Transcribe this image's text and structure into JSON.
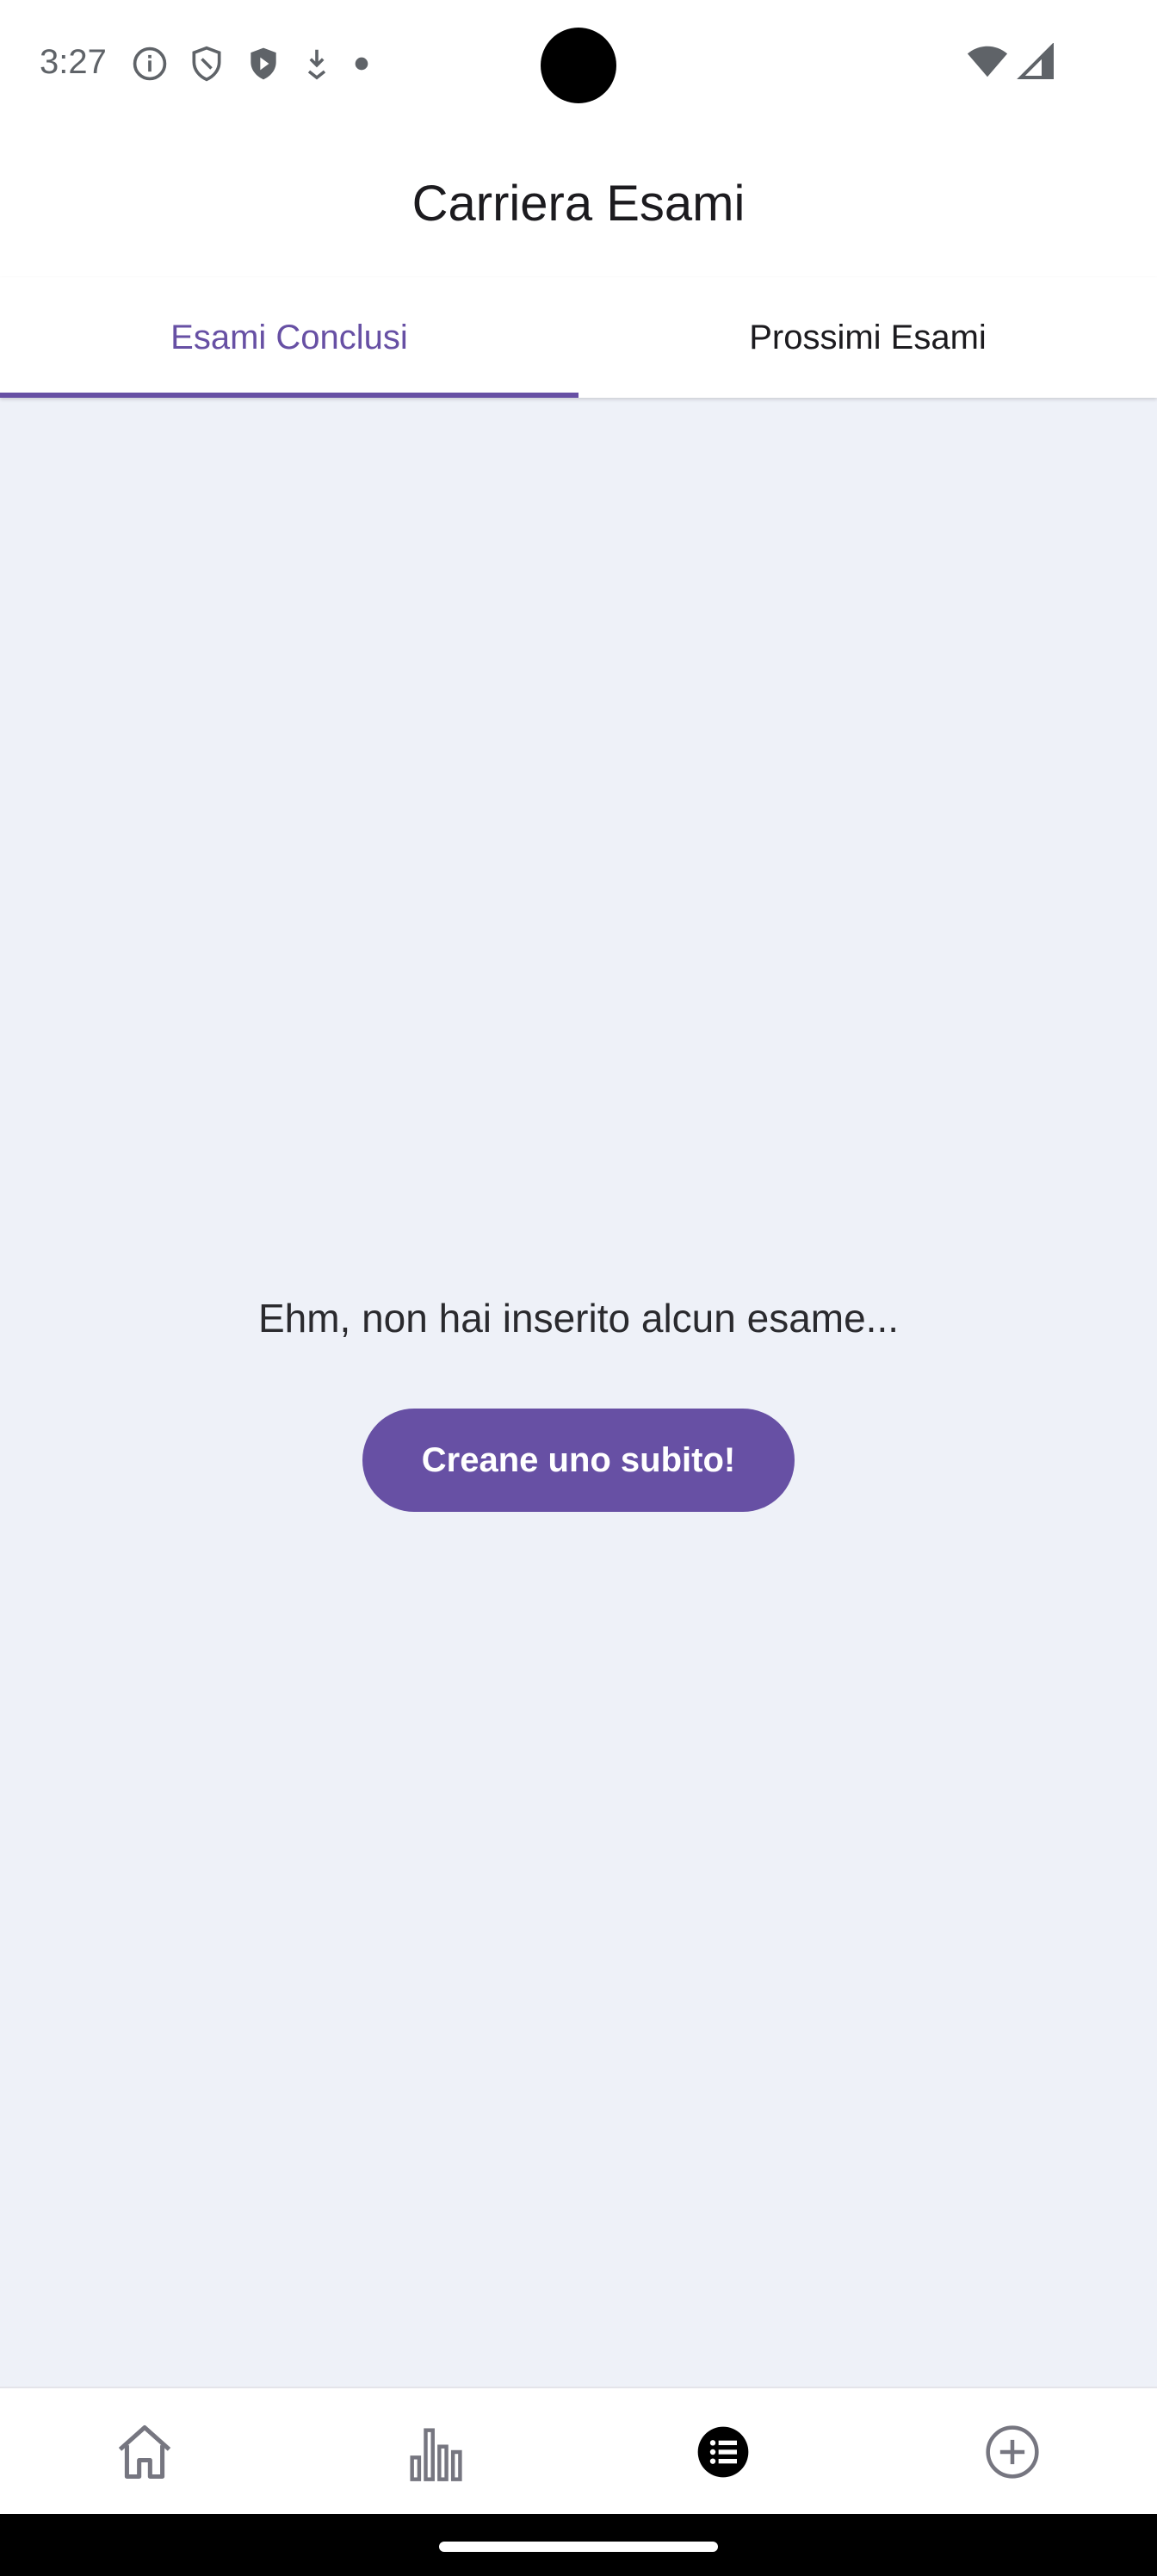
{
  "status_bar": {
    "time": "3:27",
    "left_icons": [
      "info-icon",
      "shield-icon",
      "play-shield-icon",
      "download-icon",
      "dot-icon"
    ],
    "right_icons": [
      "wifi-icon",
      "signal-icon"
    ]
  },
  "app_bar": {
    "title": "Carriera Esami"
  },
  "tabs": [
    {
      "label": "Esami Conclusi",
      "active": true
    },
    {
      "label": "Prossimi Esami",
      "active": false
    }
  ],
  "empty_state": {
    "message": "Ehm, non hai inserito alcun esame...",
    "button_label": "Creane uno subito!"
  },
  "bottom_nav": {
    "items": [
      {
        "icon": "home-icon",
        "active": false
      },
      {
        "icon": "bar-chart-icon",
        "active": false
      },
      {
        "icon": "list-icon",
        "active": true
      },
      {
        "icon": "add-circle-icon",
        "active": false
      }
    ]
  },
  "colors": {
    "accent": "#6750a4",
    "background": "#eef1f8",
    "surface": "#ffffff"
  }
}
